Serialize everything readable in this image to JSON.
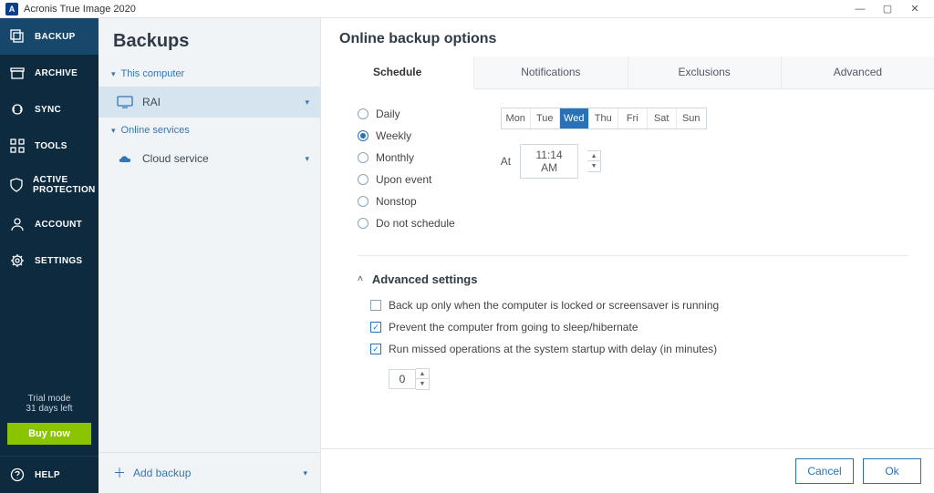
{
  "titlebar": {
    "title": "Acronis True Image 2020",
    "icon_letter": "A"
  },
  "nav": {
    "items": [
      {
        "key": "backup",
        "label": "BACKUP",
        "active": true
      },
      {
        "key": "archive",
        "label": "ARCHIVE"
      },
      {
        "key": "sync",
        "label": "SYNC"
      },
      {
        "key": "tools",
        "label": "TOOLS"
      },
      {
        "key": "active-protection",
        "label": "ACTIVE\nPROTECTION"
      },
      {
        "key": "account",
        "label": "ACCOUNT"
      },
      {
        "key": "settings",
        "label": "SETTINGS"
      }
    ],
    "trial_line1": "Trial mode",
    "trial_line2": "31 days left",
    "buy_label": "Buy now",
    "help_label": "HELP"
  },
  "tree": {
    "title": "Backups",
    "sections": [
      {
        "label": "This computer",
        "items": [
          {
            "label": "RAI",
            "icon": "monitor",
            "selected": true
          }
        ]
      },
      {
        "label": "Online services",
        "items": [
          {
            "label": "Cloud service",
            "icon": "cloud",
            "selected": false
          }
        ]
      }
    ],
    "add_label": "Add backup"
  },
  "main": {
    "title": "Online backup options",
    "tabs": [
      {
        "label": "Schedule",
        "active": true
      },
      {
        "label": "Notifications"
      },
      {
        "label": "Exclusions"
      },
      {
        "label": "Advanced"
      }
    ],
    "schedule": {
      "frequency_options": [
        {
          "key": "daily",
          "label": "Daily"
        },
        {
          "key": "weekly",
          "label": "Weekly",
          "selected": true
        },
        {
          "key": "monthly",
          "label": "Monthly"
        },
        {
          "key": "event",
          "label": "Upon event"
        },
        {
          "key": "nonstop",
          "label": "Nonstop"
        },
        {
          "key": "none",
          "label": "Do not schedule"
        }
      ],
      "days": [
        {
          "abbr": "Mon"
        },
        {
          "abbr": "Tue"
        },
        {
          "abbr": "Wed",
          "selected": true
        },
        {
          "abbr": "Thu"
        },
        {
          "abbr": "Fri"
        },
        {
          "abbr": "Sat"
        },
        {
          "abbr": "Sun"
        }
      ],
      "at_label": "At",
      "time_value": "11:14 AM"
    },
    "advanced": {
      "heading": "Advanced settings",
      "checks": [
        {
          "label": "Back up only when the computer is locked or screensaver is running",
          "checked": false
        },
        {
          "label": "Prevent the computer from going to sleep/hibernate",
          "checked": true
        },
        {
          "label": "Run missed operations at the system startup with delay (in minutes)",
          "checked": true
        }
      ],
      "delay_value": "0"
    },
    "footer": {
      "cancel": "Cancel",
      "ok": "Ok"
    }
  }
}
